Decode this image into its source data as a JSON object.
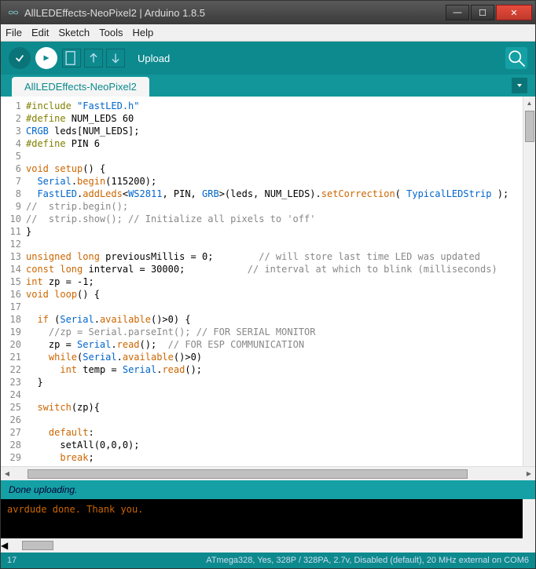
{
  "window": {
    "title": "AllLEDEffects-NeoPixel2 | Arduino 1.8.5"
  },
  "menu": {
    "file": "File",
    "edit": "Edit",
    "sketch": "Sketch",
    "tools": "Tools",
    "help": "Help"
  },
  "toolbar": {
    "action_label": "Upload"
  },
  "tab": {
    "name": "AllLEDEffects-NeoPixel2"
  },
  "code": {
    "lines": [
      {
        "n": 1,
        "h": "<span class='ppkw'>#include</span> <span class='str'>\"FastLED.h\"</span>"
      },
      {
        "n": 2,
        "h": "<span class='ppkw'>#define</span> NUM_LEDS 60"
      },
      {
        "n": 3,
        "h": "<span class='id'>CRGB</span> leds[NUM_LEDS];"
      },
      {
        "n": 4,
        "h": "<span class='ppkw'>#define</span> PIN 6"
      },
      {
        "n": 5,
        "h": ""
      },
      {
        "n": 6,
        "h": "<span class='kw'>void</span> <span class='fn'>setup</span>() {"
      },
      {
        "n": 7,
        "h": "  <span class='id'>Serial</span>.<span class='fn'>begin</span>(115200);"
      },
      {
        "n": 8,
        "h": "  <span class='id'>FastLED</span>.<span class='fn'>addLeds</span>&lt;<span class='id'>WS2811</span>, PIN, <span class='id'>GRB</span>&gt;(leds, NUM_LEDS).<span class='fn'>setCorrection</span>( <span class='id'>TypicalLEDStrip</span> );"
      },
      {
        "n": 9,
        "h": "<span class='cm'>//  strip.begin();</span>"
      },
      {
        "n": 10,
        "h": "<span class='cm'>//  strip.show(); // Initialize all pixels to 'off'</span>"
      },
      {
        "n": 11,
        "h": "}"
      },
      {
        "n": 12,
        "h": ""
      },
      {
        "n": 13,
        "h": "<span class='kw'>unsigned</span> <span class='kw'>long</span> previousMillis = 0;        <span class='cm'>// will store last time LED was updated</span>"
      },
      {
        "n": 14,
        "h": "<span class='kw'>const</span> <span class='kw'>long</span> interval = 30000;           <span class='cm'>// interval at which to blink (milliseconds)</span>"
      },
      {
        "n": 15,
        "h": "<span class='kw'>int</span> zp = -1;"
      },
      {
        "n": 16,
        "h": "<span class='kw'>void</span> <span class='fn'>loop</span>() {"
      },
      {
        "n": 17,
        "h": ""
      },
      {
        "n": 18,
        "h": "  <span class='kw'>if</span> (<span class='id'>Serial</span>.<span class='fn'>available</span>()&gt;0) {"
      },
      {
        "n": 19,
        "h": "    <span class='cm'>//zp = Serial.parseInt(); // FOR SERIAL MONITOR</span>"
      },
      {
        "n": 20,
        "h": "    zp = <span class='id'>Serial</span>.<span class='fn'>read</span>();  <span class='cm'>// FOR ESP COMMUNICATION</span>"
      },
      {
        "n": 21,
        "h": "    <span class='kw'>while</span>(<span class='id'>Serial</span>.<span class='fn'>available</span>()&gt;0)"
      },
      {
        "n": 22,
        "h": "      <span class='kw'>int</span> temp = <span class='id'>Serial</span>.<span class='fn'>read</span>();"
      },
      {
        "n": 23,
        "h": "  }"
      },
      {
        "n": 24,
        "h": ""
      },
      {
        "n": 25,
        "h": "  <span class='kw'>switch</span>(zp){"
      },
      {
        "n": 26,
        "h": ""
      },
      {
        "n": 27,
        "h": "    <span class='kw'>default</span>:"
      },
      {
        "n": 28,
        "h": "      setAll(0,0,0);"
      },
      {
        "n": 29,
        "h": "      <span class='kw'>break</span>;"
      }
    ]
  },
  "status": {
    "text": "Done uploading."
  },
  "console": {
    "text": "avrdude done.  Thank you."
  },
  "footer": {
    "line": "17",
    "board": "ATmega328, Yes, 328P / 328PA, 2.7v, Disabled (default), 20 MHz external on COM6"
  }
}
